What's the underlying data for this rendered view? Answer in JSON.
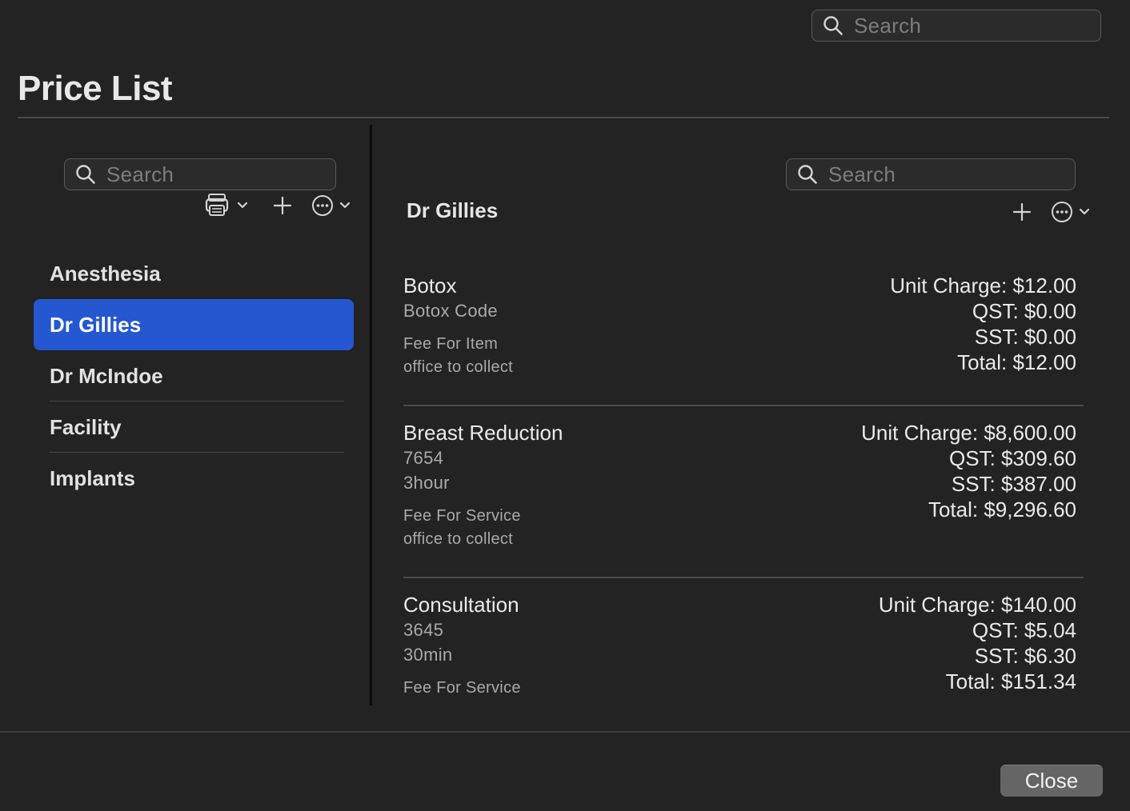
{
  "window": {
    "title": "Price List"
  },
  "top_search": {
    "placeholder": "Search",
    "icon": "search-icon"
  },
  "sidebar": {
    "search": {
      "placeholder": "Search",
      "icon": "search-icon"
    },
    "toolbar": {
      "print_icon": "printer-icon",
      "add_icon": "plus-icon",
      "more_icon": "ellipsis-circle-icon"
    },
    "items": [
      {
        "label": "Anesthesia",
        "selected": false
      },
      {
        "label": "Dr Gillies",
        "selected": true
      },
      {
        "label": "Dr McIndoe",
        "selected": false
      },
      {
        "label": "Facility",
        "selected": false
      },
      {
        "label": "Implants",
        "selected": false
      }
    ]
  },
  "detail": {
    "search": {
      "placeholder": "Search",
      "icon": "search-icon"
    },
    "title": "Dr Gillies",
    "toolbar": {
      "add_icon": "plus-icon",
      "more_icon": "ellipsis-circle-icon"
    },
    "items": [
      {
        "name": "Botox",
        "code": "Botox Code",
        "fee_type": "Fee For Item",
        "collection": "office to collect",
        "unit_charge": "Unit Charge: $12.00",
        "qst": "QST: $0.00",
        "sst": "SST: $0.00",
        "total": "Total: $12.00"
      },
      {
        "name": "Breast Reduction",
        "code": "7654",
        "duration": "3hour",
        "fee_type": "Fee For Service",
        "collection": "office to collect",
        "unit_charge": "Unit Charge: $8,600.00",
        "qst": "QST: $309.60",
        "sst": "SST: $387.00",
        "total": "Total: $9,296.60"
      },
      {
        "name": "Consultation",
        "code": "3645",
        "duration": "30min",
        "fee_type": "Fee For Service",
        "unit_charge": "Unit Charge: $140.00",
        "qst": "QST: $5.04",
        "sst": "SST: $6.30",
        "total": "Total: $151.34"
      }
    ]
  },
  "footer": {
    "close_label": "Close"
  },
  "colors": {
    "background": "#232323",
    "selection": "#2457d0",
    "button": "#656565"
  }
}
